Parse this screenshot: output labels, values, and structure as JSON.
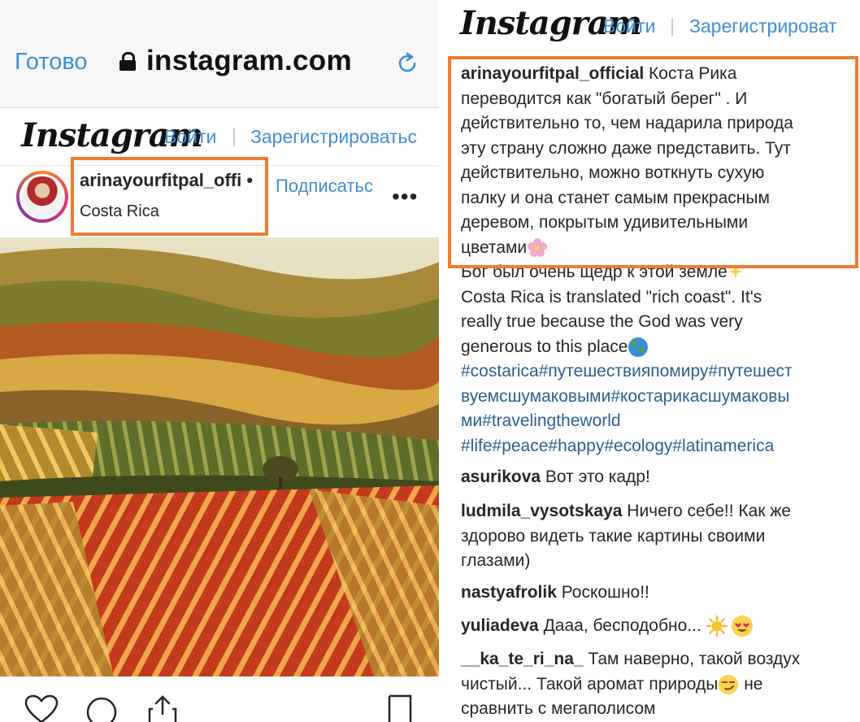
{
  "browser": {
    "done_label": "Готово",
    "url": "instagram.com"
  },
  "header": {
    "logo": "Instagram",
    "login": "Войти",
    "register_left": "Зарегистрироватьс",
    "register_right": "Зарегистрироват"
  },
  "post": {
    "username": "arinayourfitpal_offi",
    "dot": "•",
    "follow": "Подписатьс",
    "location": "Costa Rica",
    "more": "•••"
  },
  "caption": {
    "username": "arinayourfitpal_official",
    "first_line_text": " Коста Рика",
    "lines": [
      "переводится как \"богатый берег\" . И",
      "действительно то, чем надарила природа",
      "эту страну сложно даже представить. Тут",
      "действительно, можно воткнуть сухую",
      "палку и она станет самым прекрасным",
      "деревом, покрытым удивительными"
    ],
    "flower_line": "цветами",
    "god_line": "Бог был очень щедр к этой земле",
    "english_lines": [
      "Costa Rica is translated \"rich coast\". It's",
      "really true because the God was very"
    ],
    "english_last": "generous to this place",
    "hashtag_lines": [
      "#costarica#путешествияпомиру#путешест",
      "вуемсшумаковыми#костарикасшумаковы",
      "ми#travelingtheworld",
      "#life#peace#happy#ecology#latinamerica"
    ]
  },
  "comments": [
    {
      "user": "asurikova",
      "text": " Вот это кадр!"
    },
    {
      "user": "ludmila_vysotskaya",
      "text": " Ничего себе!! Как же",
      "more": [
        "здорово видеть такие картины своими",
        "глазами)"
      ]
    },
    {
      "user": "nastyafrolik",
      "text": " Роскошно!!"
    },
    {
      "user": "yuliadeva",
      "text": " Дааа, бесподобно... "
    },
    {
      "user": "__ka_te_ri_na_",
      "text": " Там наверно, такой воздух",
      "line2": "чистый... Такой аромат природы",
      "line2_end": " не",
      "line3": "сравнить с мегаполисом"
    }
  ],
  "colors": {
    "link_blue": "#3d8fd6",
    "hashtag_blue": "#2d5f8f",
    "highlight_orange": "#ed7d31"
  },
  "icons": [
    "lock-icon",
    "reload-icon",
    "heart-icon",
    "comment-icon",
    "share-icon",
    "bookmark-icon",
    "flower-emoji",
    "sparkles-emoji",
    "globe-emoji",
    "sun-emoji",
    "heart-eyes-emoji",
    "smirk-emoji"
  ]
}
